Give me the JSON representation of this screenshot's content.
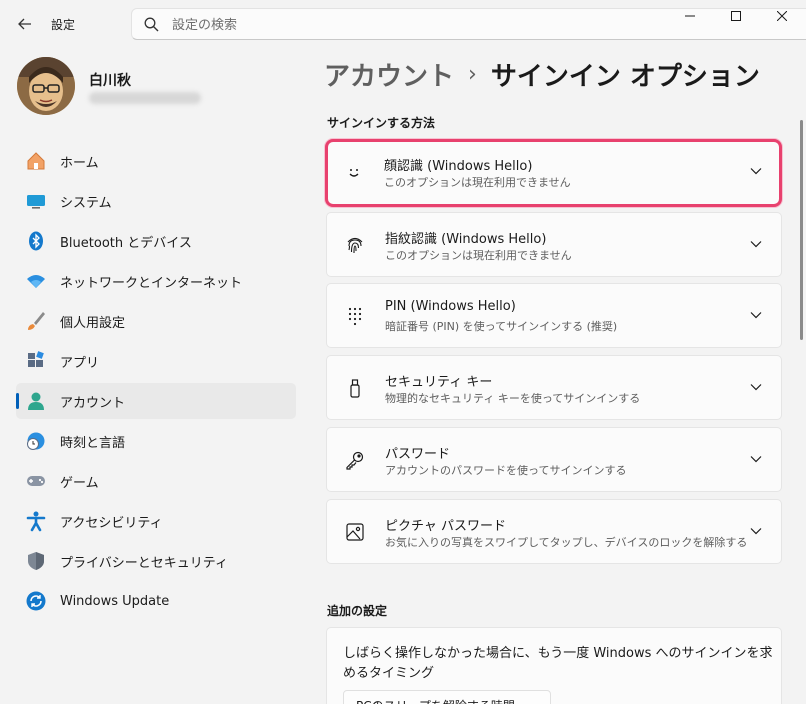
{
  "window": {
    "title": "設定",
    "controls": {
      "minimize": "minimize-icon",
      "maximize": "maximize-icon",
      "close": "close-icon"
    }
  },
  "search": {
    "placeholder": "設定の検索"
  },
  "profile": {
    "name": "白川秋"
  },
  "sidebar": {
    "items": [
      {
        "label": "ホーム",
        "icon": "home-icon"
      },
      {
        "label": "システム",
        "icon": "monitor-icon"
      },
      {
        "label": "Bluetooth とデバイス",
        "icon": "bluetooth-icon"
      },
      {
        "label": "ネットワークとインターネット",
        "icon": "wifi-icon"
      },
      {
        "label": "個人用設定",
        "icon": "brush-icon"
      },
      {
        "label": "アプリ",
        "icon": "apps-icon"
      },
      {
        "label": "アカウント",
        "icon": "person-icon",
        "active": true
      },
      {
        "label": "時刻と言語",
        "icon": "globe-clock-icon"
      },
      {
        "label": "ゲーム",
        "icon": "gamepad-icon"
      },
      {
        "label": "アクセシビリティ",
        "icon": "accessibility-icon"
      },
      {
        "label": "プライバシーとセキュリティ",
        "icon": "shield-icon"
      },
      {
        "label": "Windows Update",
        "icon": "update-icon"
      }
    ]
  },
  "main": {
    "breadcrumb": {
      "parent": "アカウント",
      "separator": "›",
      "current": "サインイン オプション"
    },
    "signin_section_title": "サインインする方法",
    "options": [
      {
        "title": "顔認識 (Windows Hello)",
        "desc": "このオプションは現在利用できません",
        "icon": "face-icon",
        "highlighted": true
      },
      {
        "title": "指紋認識 (Windows Hello)",
        "desc": "このオプションは現在利用できません",
        "icon": "fingerprint-icon"
      },
      {
        "title": "PIN (Windows Hello)",
        "desc": "暗証番号 (PIN) を使ってサインインする (推奨)",
        "icon": "pin-keypad-icon"
      },
      {
        "title": "セキュリティ キー",
        "desc": "物理的なセキュリティ キーを使ってサインインする",
        "icon": "usb-key-icon"
      },
      {
        "title": "パスワード",
        "desc": "アカウントのパスワードを使ってサインインする",
        "icon": "key-icon"
      },
      {
        "title": "ピクチャ パスワード",
        "desc": "お気に入りの写真をスワイプしてタップし、デバイスのロックを解除する",
        "icon": "picture-icon"
      }
    ],
    "extra_section_title": "追加の設定",
    "extra": {
      "text": "しばらく操作しなかった場合に、もう一度 Windows へのサインインを求めるタイミング",
      "select_value": "PCのスリープを解除する時間"
    }
  },
  "colors": {
    "accent": "#005fb8",
    "highlight_border": "#e8416e",
    "background": "#f3f3f3",
    "card": "#fbfbfb"
  }
}
